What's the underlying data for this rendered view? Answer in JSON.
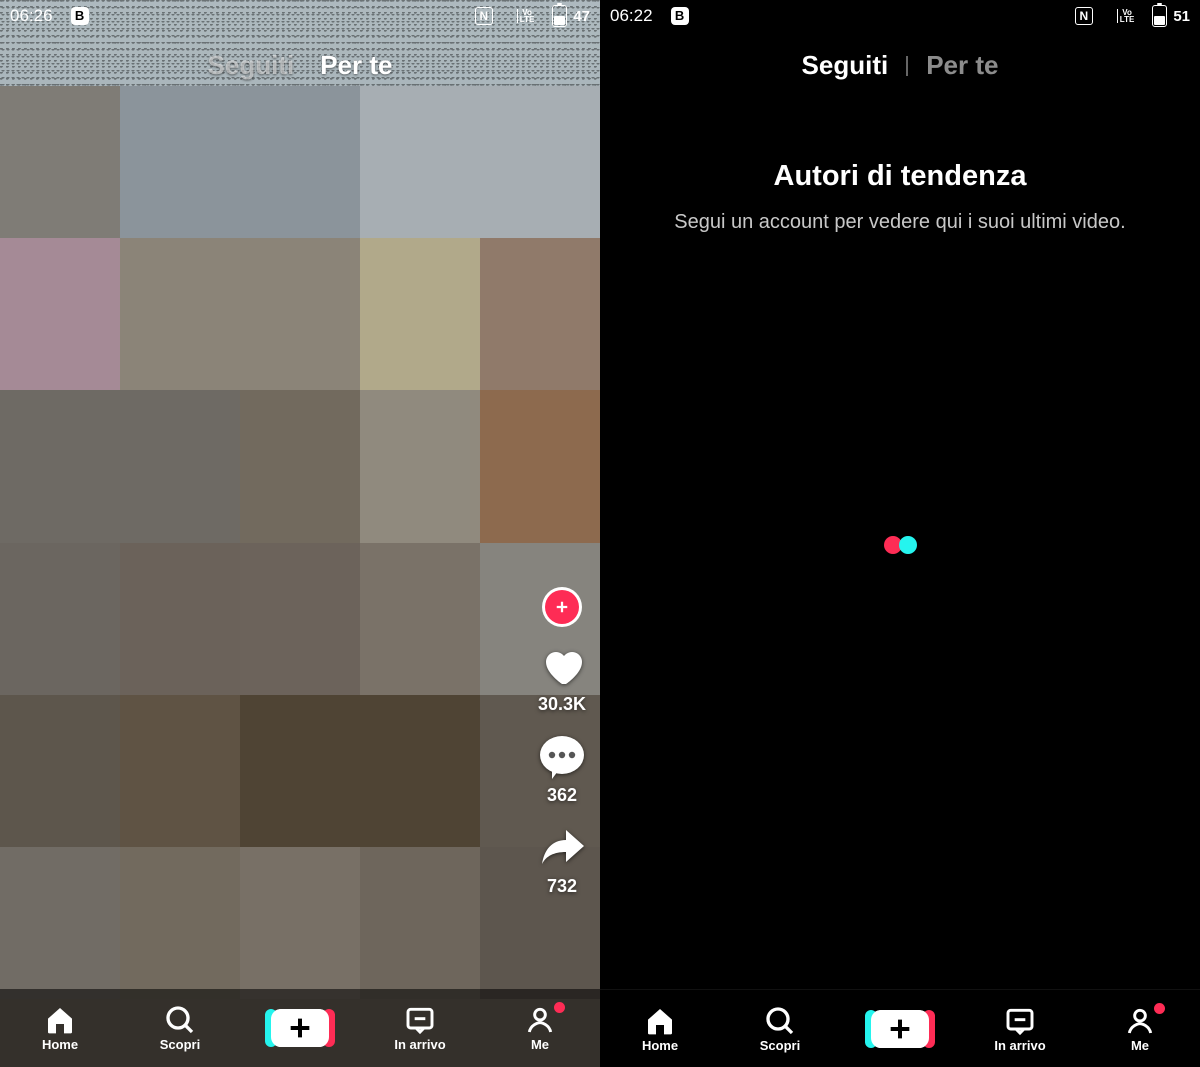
{
  "left": {
    "status": {
      "time": "06:26",
      "battery": "47",
      "volte": "VoLTE"
    },
    "tabs": {
      "following": "Seguiti",
      "foryou": "Per te",
      "active": "foryou"
    },
    "actions": {
      "likes": "30.3K",
      "comments": "362",
      "shares": "732"
    },
    "mosaic_colors": [
      "#7f7c76",
      "#8b949b",
      "#8b949b",
      "#a7aeb3",
      "#a7aeb3",
      "#a58a96",
      "#8b8478",
      "#8b8478",
      "#b1a98a",
      "#907a6a",
      "#6e6a64",
      "#6e6a64",
      "#726a5e",
      "#908a7e",
      "#8d6a4e",
      "#6b6660",
      "#6b625a",
      "#6c635b",
      "#7a7268",
      "#86847e",
      "#5d564c",
      "#5f5344",
      "#4f4434",
      "#4f4434",
      "#605950",
      "#716c65",
      "#726a5e",
      "#787066",
      "#6e665c",
      "#5d564e"
    ]
  },
  "right": {
    "status": {
      "time": "06:22",
      "battery": "51",
      "volte": "VoLTE"
    },
    "tabs": {
      "following": "Seguiti",
      "foryou": "Per te",
      "active": "following"
    },
    "empty": {
      "title": "Autori di tendenza",
      "subtitle": "Segui un account per vedere qui i suoi ultimi video."
    }
  },
  "nav": {
    "home": "Home",
    "discover": "Scopri",
    "inbox": "In arrivo",
    "me": "Me"
  }
}
